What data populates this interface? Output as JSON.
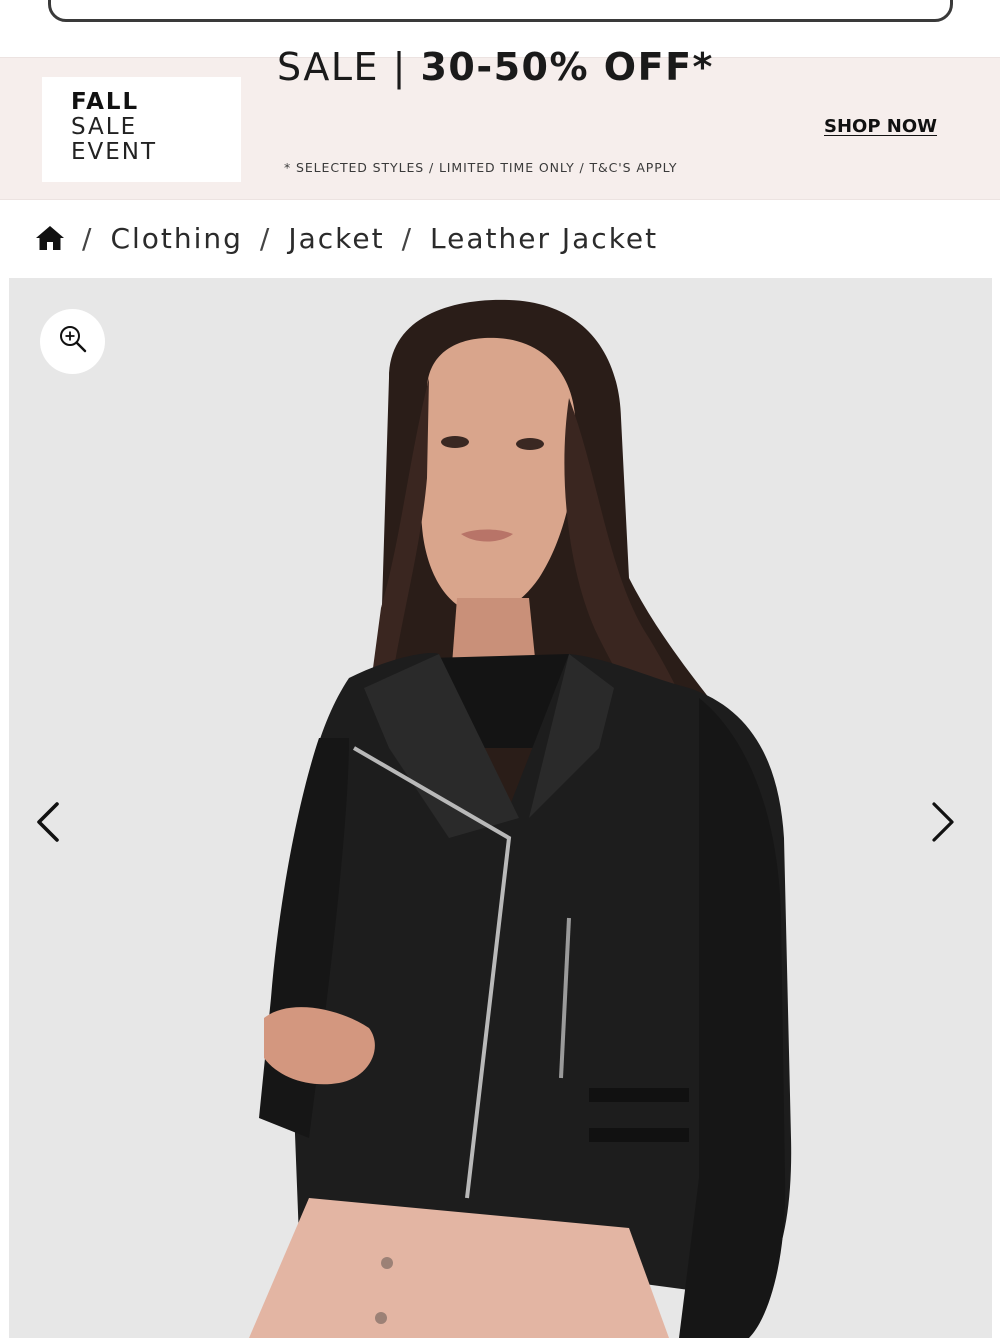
{
  "promo": {
    "box_line1": "FALL",
    "box_line2": "SALE",
    "box_line3": "EVENT",
    "headline_light": "SALE | ",
    "headline_bold": "30-50% OFF*",
    "subline": "* SELECTED STYLES / LIMITED TIME ONLY / T&C'S APPLY",
    "cta": "SHOP NOW"
  },
  "breadcrumb": {
    "items": [
      "Clothing",
      "Jacket",
      "Leather Jacket"
    ],
    "separator": "/"
  },
  "gallery": {
    "icons": {
      "zoom": "zoom-in-icon",
      "prev": "chevron-left-icon",
      "next": "chevron-right-icon",
      "home": "home-icon"
    }
  },
  "colors": {
    "banner_bg": "#f6eeec",
    "gallery_bg": "#e7e7e7",
    "jacket": "#1d1d1d",
    "skirt": "#e3b5a3"
  }
}
